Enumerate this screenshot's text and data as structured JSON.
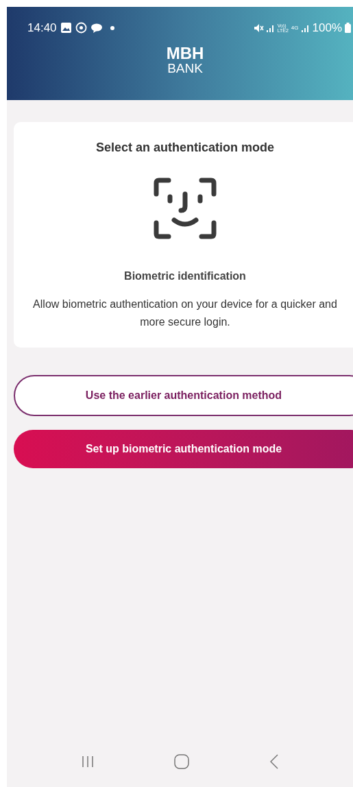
{
  "status_bar": {
    "time": "14:40",
    "volte": "Vo))",
    "lte": "LTE2",
    "network": "4G",
    "battery": "100%"
  },
  "header": {
    "logo_top": "MBH",
    "logo_bottom": "BANK"
  },
  "card": {
    "title": "Select an authentication mode",
    "subtitle": "Biometric identification",
    "description": "Allow biometric authentication on your device for a quicker and more secure login."
  },
  "buttons": [
    {
      "label": "Use the earlier authentication method",
      "kind": "outline"
    },
    {
      "label": "Set up biometric authentication mode",
      "kind": "filled"
    }
  ]
}
